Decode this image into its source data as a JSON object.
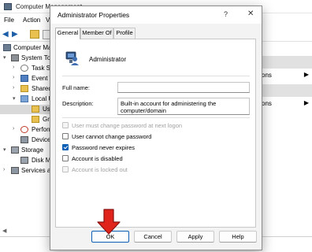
{
  "bg": {
    "title": "Computer Management",
    "menu": [
      "File",
      "Action",
      "V"
    ],
    "tree": [
      {
        "label": "Computer Ma",
        "exp": "",
        "icon": "computer-icon"
      },
      {
        "label": "System To",
        "exp": "▾",
        "icon": "tools-icon"
      },
      {
        "label": "Task Sc",
        "exp": "›",
        "icon": "clock-icon"
      },
      {
        "label": "Event V",
        "exp": "›",
        "icon": "event-icon"
      },
      {
        "label": "Shared",
        "exp": "›",
        "icon": "share-icon"
      },
      {
        "label": "Local U",
        "exp": "▾",
        "icon": "users-icon"
      },
      {
        "label": "Us",
        "exp": "",
        "icon": "folder-icon"
      },
      {
        "label": "Gr",
        "exp": "",
        "icon": "folder-icon"
      },
      {
        "label": "Perform",
        "exp": "›",
        "icon": "perf-icon"
      },
      {
        "label": "Device",
        "exp": "",
        "icon": "device-icon"
      },
      {
        "label": "Storage",
        "exp": "▾",
        "icon": "storage-icon"
      },
      {
        "label": "Disk M",
        "exp": "",
        "icon": "disk-icon"
      },
      {
        "label": "Services a",
        "exp": "›",
        "icon": "services-icon"
      }
    ],
    "right_rows": [
      "ons",
      "ons"
    ]
  },
  "dialog": {
    "title": "Administrator Properties",
    "help_glyph": "?",
    "close_glyph": "✕",
    "tabs": [
      "General",
      "Member Of",
      "Profile"
    ],
    "user_name": "Administrator",
    "full_name_label": "Full name:",
    "full_name_value": "",
    "description_label": "Description:",
    "description_value": "Built-in account for administering the computer/domain",
    "checkboxes": [
      {
        "label": "User must change password at next logon",
        "checked": false,
        "disabled": true
      },
      {
        "label": "User cannot change password",
        "checked": false,
        "disabled": false
      },
      {
        "label": "Password never expires",
        "checked": true,
        "disabled": false
      },
      {
        "label": "Account is disabled",
        "checked": false,
        "disabled": false
      },
      {
        "label": "Account is locked out",
        "checked": false,
        "disabled": true
      }
    ],
    "buttons": {
      "ok": "OK",
      "cancel": "Cancel",
      "apply": "Apply",
      "help": "Help"
    }
  },
  "colors": {
    "accent": "#0a5fb4",
    "annotation_arrow": "#e0241b"
  }
}
